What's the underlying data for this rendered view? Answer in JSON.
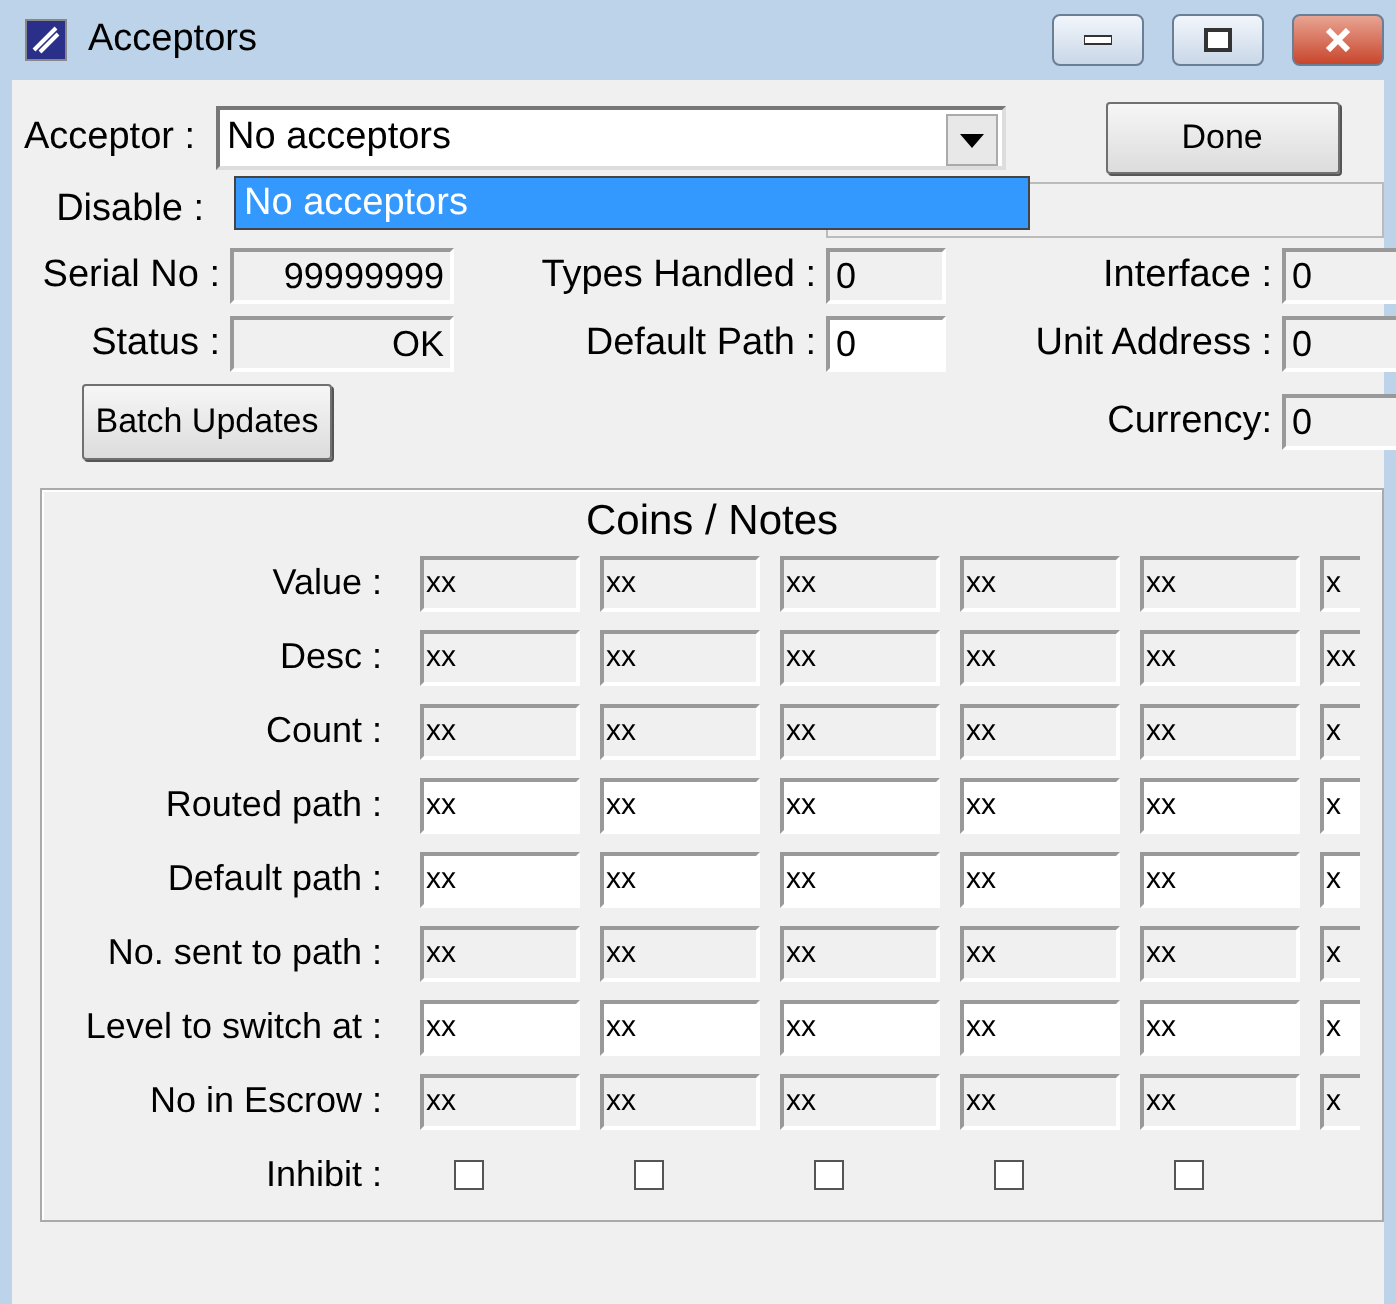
{
  "window": {
    "title": "Acceptors"
  },
  "acceptor": {
    "label": "Acceptor :",
    "value": "No acceptors",
    "expanded": true,
    "options": [
      {
        "label": "No acceptors",
        "selected": true
      }
    ]
  },
  "done_button": "Done",
  "disable": {
    "label": "Disable :"
  },
  "info_left": [
    {
      "label": "Serial No :",
      "value": "99999999",
      "kind": "readonly"
    },
    {
      "label": "Status :",
      "value": "OK",
      "kind": "readonly"
    }
  ],
  "info_middle": [
    {
      "label": "Types Handled :",
      "value": "0",
      "kind": "readonly"
    },
    {
      "label": "Default Path :",
      "value": "0",
      "kind": "editable"
    }
  ],
  "info_right": [
    {
      "label": "Interface :",
      "value": "0",
      "kind": "readonly"
    },
    {
      "label": "Unit Address :",
      "value": "0",
      "kind": "readonly"
    },
    {
      "label": "Currency:",
      "value": "0",
      "kind": "readonly"
    }
  ],
  "batch_button": "Batch Updates",
  "coins": {
    "title": "Coins / Notes",
    "rows": [
      {
        "label": "Value :",
        "kind": "readonly",
        "cells": [
          "xx",
          "xx",
          "xx",
          "xx",
          "xx",
          "x"
        ]
      },
      {
        "label": "Desc :",
        "kind": "readonly",
        "cells": [
          "xx",
          "xx",
          "xx",
          "xx",
          "xx",
          "xx"
        ]
      },
      {
        "label": "Count :",
        "kind": "readonly",
        "cells": [
          "xx",
          "xx",
          "xx",
          "xx",
          "xx",
          "x"
        ]
      },
      {
        "label": "Routed path :",
        "kind": "editable",
        "cells": [
          "xx",
          "xx",
          "xx",
          "xx",
          "xx",
          "x"
        ]
      },
      {
        "label": "Default path :",
        "kind": "editable",
        "cells": [
          "xx",
          "xx",
          "xx",
          "xx",
          "xx",
          "x"
        ]
      },
      {
        "label": "No. sent to path :",
        "kind": "readonly",
        "cells": [
          "xx",
          "xx",
          "xx",
          "xx",
          "xx",
          "x"
        ]
      },
      {
        "label": "Level to switch at :",
        "kind": "editable",
        "cells": [
          "xx",
          "xx",
          "xx",
          "xx",
          "xx",
          "x"
        ]
      },
      {
        "label": "No in Escrow :",
        "kind": "readonly",
        "cells": [
          "xx",
          "xx",
          "xx",
          "xx",
          "xx",
          "x"
        ]
      },
      {
        "label": "Inhibit :",
        "kind": "checkbox",
        "checks": [
          false,
          false,
          false,
          false,
          false
        ]
      }
    ]
  }
}
